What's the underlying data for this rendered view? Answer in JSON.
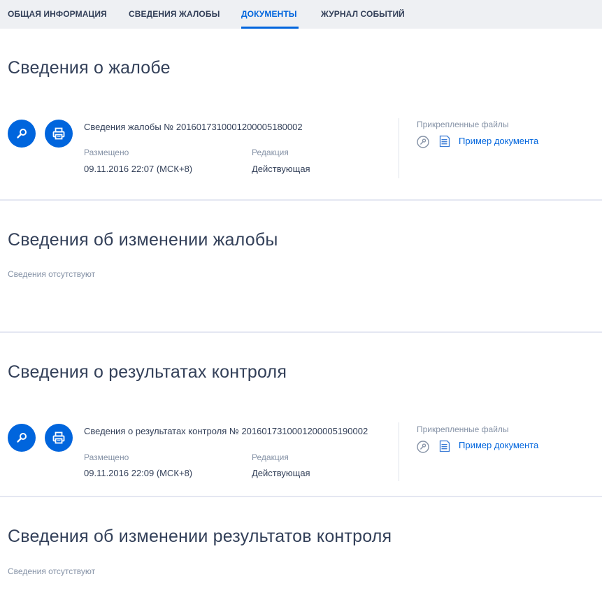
{
  "tabs": [
    {
      "label": "ОБЩАЯ ИНФОРМАЦИЯ",
      "active": false
    },
    {
      "label": "СВЕДЕНИЯ ЖАЛОБЫ",
      "active": false
    },
    {
      "label": "ДОКУМЕНТЫ",
      "active": true
    },
    {
      "label": "ЖУРНАЛ СОБЫТИЙ",
      "active": false
    }
  ],
  "colors": {
    "accent": "#0065dd",
    "text": "#334059",
    "muted": "#8592a6",
    "tab_bar": "#eef0f3"
  },
  "sections": [
    {
      "title": "Сведения о жалобе",
      "document": {
        "title": "Сведения жалобы № 20160173100012000051800​02",
        "placed_label": "Размещено",
        "placed_value": "09.11.2016 22:07 (МСК+8)",
        "edition_label": "Редакция",
        "edition_value": "Действующая",
        "files_label": "Прикрепленные файлы",
        "file_name": "Пример документа",
        "view_icon": "magnifier-icon",
        "print_icon": "printer-icon"
      }
    },
    {
      "title": "Сведения об изменении жалобы",
      "empty_text": "Сведения отсутствуют"
    },
    {
      "title": "Сведения о результатах контроля",
      "document": {
        "title": "Сведения о результатах контроля № 201601731000120000519000​2",
        "placed_label": "Размещено",
        "placed_value": "09.11.2016 22:09 (МСК+8)",
        "edition_label": "Редакция",
        "edition_value": "Действующая",
        "files_label": "Прикрепленные файлы",
        "file_name": "Пример документа",
        "view_icon": "magnifier-icon",
        "print_icon": "printer-icon"
      }
    },
    {
      "title": "Сведения об изменении результатов контроля",
      "empty_text": "Сведения отсутствуют"
    }
  ]
}
